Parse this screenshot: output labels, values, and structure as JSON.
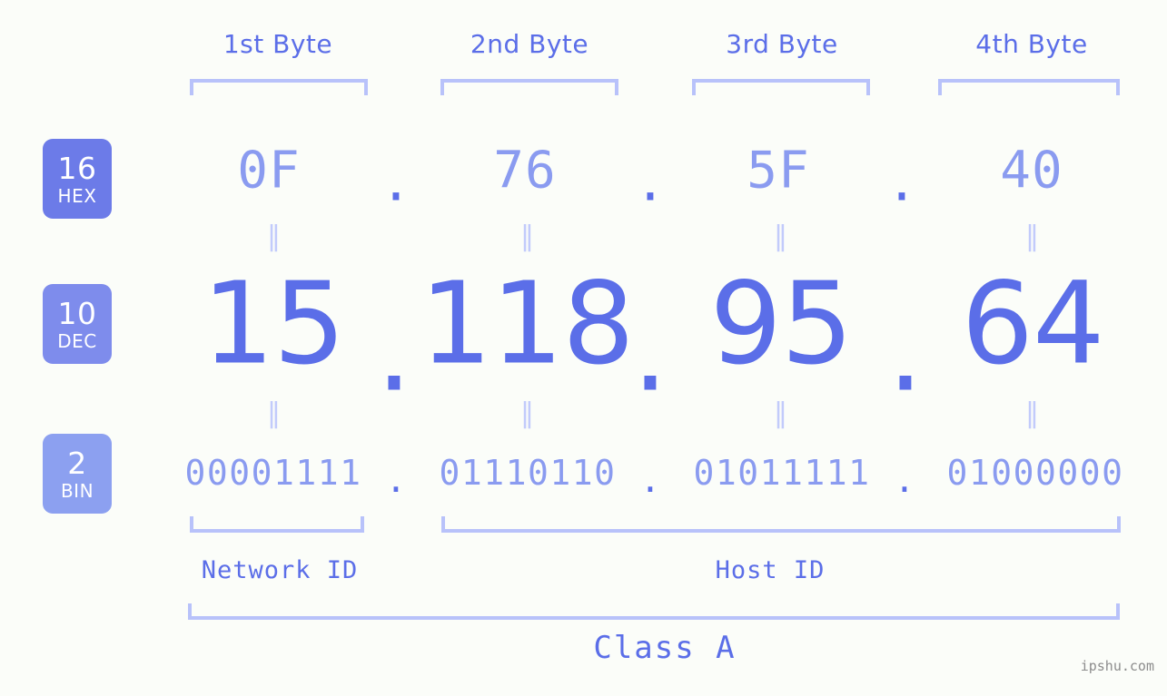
{
  "background_color": "#fbfdf9",
  "colors": {
    "accent_strong": "#5b6ee8",
    "accent_light": "#8a9bf0",
    "bracket": "#b8c2fa",
    "separator": "#c2cbfb",
    "badge_hex": "#6c7be8",
    "badge_dec": "#7e8cec",
    "badge_bin": "#8ca0f0",
    "watermark": "#8c8c8c"
  },
  "byte_headers": [
    {
      "label": "1st Byte"
    },
    {
      "label": "2nd Byte"
    },
    {
      "label": "3rd Byte"
    },
    {
      "label": "4th Byte"
    }
  ],
  "radix_badges": [
    {
      "number": "16",
      "abbr": "HEX"
    },
    {
      "number": "10",
      "abbr": "DEC"
    },
    {
      "number": "2",
      "abbr": "BIN"
    }
  ],
  "rows": {
    "hex": {
      "octets": [
        "0F",
        "76",
        "5F",
        "40"
      ],
      "separator": "."
    },
    "dec": {
      "octets": [
        "15",
        "118",
        "95",
        "64"
      ],
      "separator": "."
    },
    "bin": {
      "octets": [
        "00001111",
        "01110110",
        "01011111",
        "01000000"
      ],
      "separator": "."
    }
  },
  "equivalence_symbol": "‖",
  "segments": {
    "network_id": "Network ID",
    "host_id": "Host ID",
    "class": "Class A"
  },
  "watermark": "ipshu.com"
}
